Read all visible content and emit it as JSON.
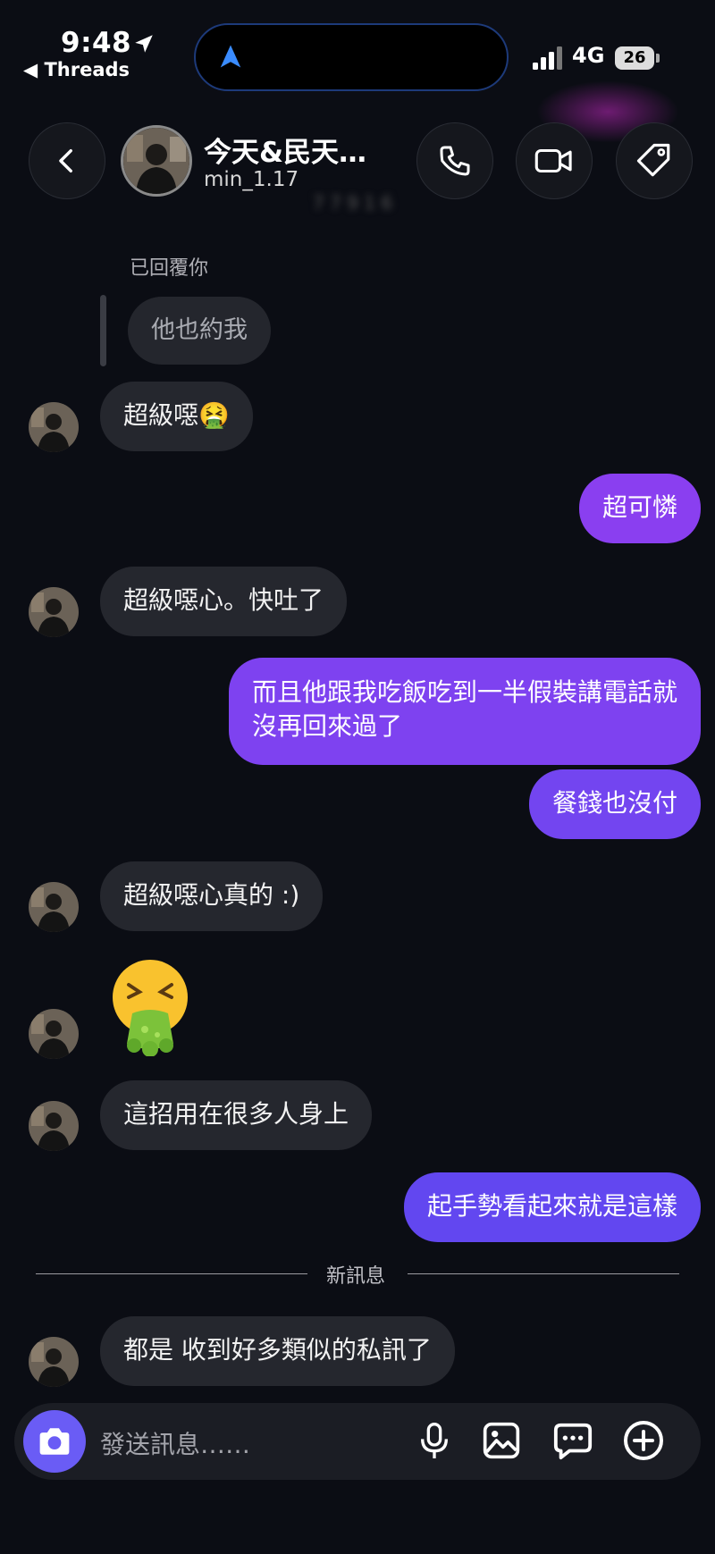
{
  "status_bar": {
    "time": "9:48",
    "back_app": "◀ Threads",
    "network": "4G",
    "battery": "26"
  },
  "header": {
    "chat_name": "今天&民天…",
    "username": "min_1.17",
    "blurred_text": "7 7 9 1 6"
  },
  "messages": {
    "reply_label": "已回覆你",
    "reply_quote": "他也約我",
    "m1": "超級噁🤮",
    "m2": "超可憐",
    "m3": "超級噁心。快吐了",
    "m4_line1": "而且他跟我吃飯吃到一半假裝講電話就",
    "m4_line2": "沒再回來過了",
    "m5": "餐錢也沒付",
    "m6": "超級噁心真的 :)",
    "m7_emoji": "🤮",
    "m8": "這招用在很多人身上",
    "m9": "起手勢看起來就是這樣",
    "new_messages_label": "新訊息",
    "m10": "都是 收到好多類似的私訊了"
  },
  "composer": {
    "placeholder": "發送訊息……"
  },
  "icons": {
    "header": [
      "back-icon",
      "phone-icon",
      "video-icon",
      "tag-icon"
    ],
    "composer": [
      "camera-icon",
      "microphone-icon",
      "image-icon",
      "sticker-icon",
      "plus-icon"
    ]
  },
  "colors": {
    "background": "#0b0d14",
    "incoming_bubble": "#25272e",
    "outgoing_bubble_top": "#8e3ff0",
    "outgoing_bubble_bottom": "#6247f0",
    "camera_button": "#6a5cf5"
  }
}
